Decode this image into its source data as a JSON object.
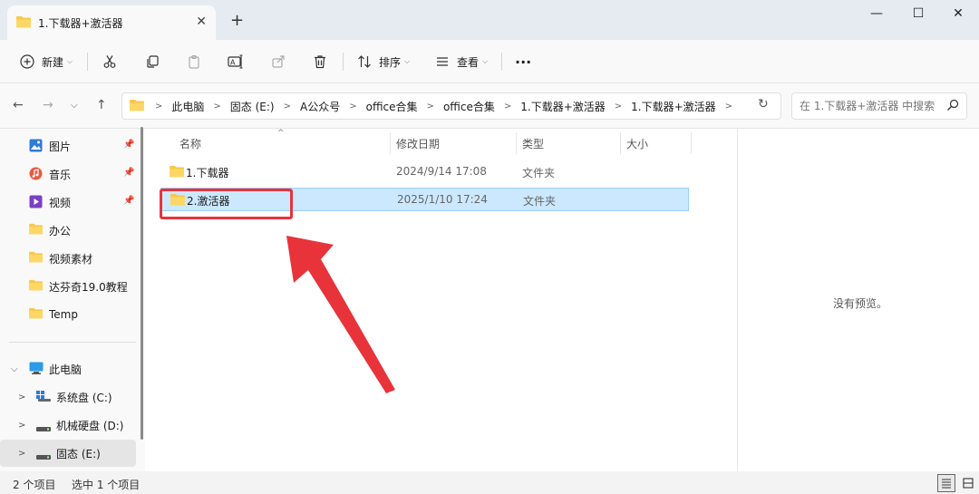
{
  "window": {
    "tab_title": "1.下载器+激活器",
    "new_tab": "+",
    "minimize": "—",
    "maximize": "☐",
    "close": "✕"
  },
  "toolbar": {
    "new_label": "新建",
    "sort_label": "排序",
    "view_label": "查看",
    "more_label": "···"
  },
  "address": {
    "crumbs": [
      "此电脑",
      "固态 (E:)",
      "A公众号",
      "office合集",
      "office合集",
      "1.下载器+激活器",
      "1.下载器+激活器"
    ],
    "search_placeholder": "在 1.下载器+激活器 中搜索"
  },
  "sidebar": {
    "items": [
      {
        "label": "图片",
        "icon": "pictures-icon",
        "pinned": true
      },
      {
        "label": "音乐",
        "icon": "music-icon",
        "pinned": true
      },
      {
        "label": "视频",
        "icon": "video-icon",
        "pinned": true
      },
      {
        "label": "办公",
        "icon": "folder-icon"
      },
      {
        "label": "视频素材",
        "icon": "folder-icon"
      },
      {
        "label": "达芬奇19.0教程",
        "icon": "folder-icon"
      },
      {
        "label": "Temp",
        "icon": "folder-icon"
      }
    ],
    "this_pc": "此电脑",
    "drives": [
      {
        "label": "系统盘 (C:)",
        "icon": "windows-drive-icon"
      },
      {
        "label": "机械硬盘 (D:)",
        "icon": "drive-icon"
      },
      {
        "label": "固态 (E:)",
        "icon": "drive-icon",
        "selected": true
      }
    ]
  },
  "columns": {
    "name": "名称",
    "modified": "修改日期",
    "type": "类型",
    "size": "大小"
  },
  "files": [
    {
      "name": "1.下载器",
      "modified": "2024/9/14 17:08",
      "type": "文件夹"
    },
    {
      "name": "2.激活器",
      "modified": "2025/1/10 17:24",
      "type": "文件夹",
      "selected": true
    }
  ],
  "preview": {
    "empty_text": "没有预览。"
  },
  "status": {
    "count": "2 个项目",
    "selected": "选中 1 个项目"
  },
  "colors": {
    "selection": "#cce8ff",
    "folder": "#f8c84a",
    "annotation": "#e8333a"
  }
}
